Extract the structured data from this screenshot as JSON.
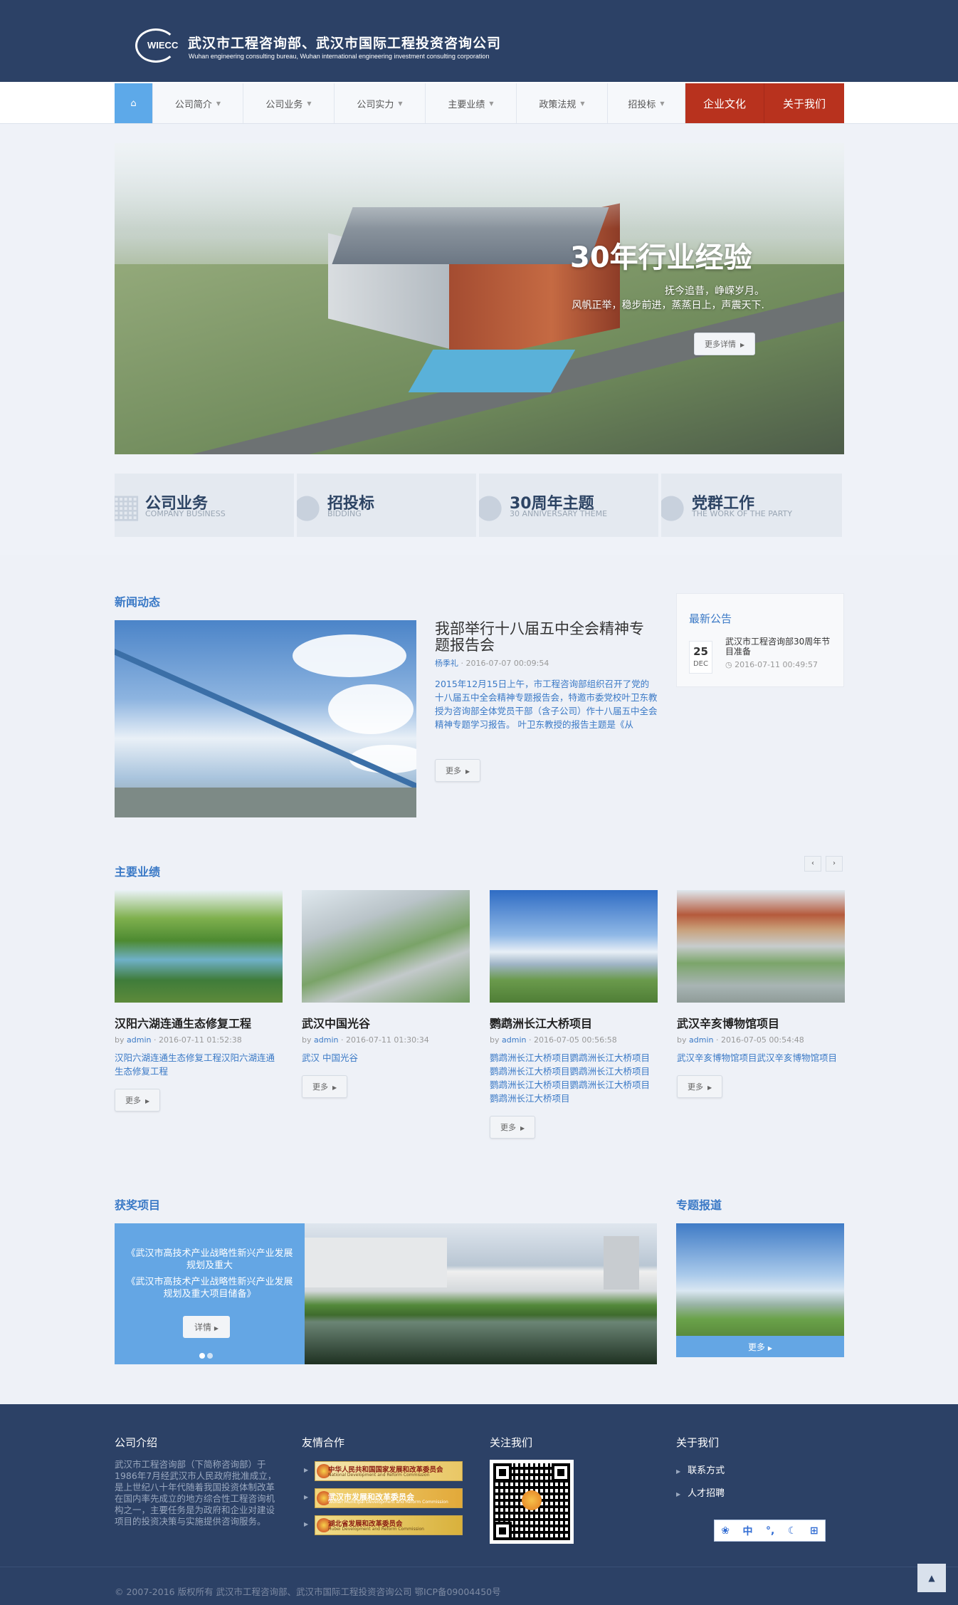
{
  "header": {
    "logo_abbr": "WIECC",
    "logo_cn": "武汉市工程咨询部、武汉市国际工程投资咨询公司",
    "logo_en": "Wuhan engineering consulting bureau, Wuhan international engineering investment consulting corporation"
  },
  "nav": {
    "home_icon": "home-icon",
    "items": [
      {
        "label": "公司简介"
      },
      {
        "label": "公司业务"
      },
      {
        "label": "公司实力"
      },
      {
        "label": "主要业绩"
      },
      {
        "label": "政策法规"
      },
      {
        "label": "招投标"
      }
    ],
    "culture": "企业文化",
    "about": "关于我们"
  },
  "banner": {
    "title": "30年行业经验",
    "line1": "抚今追昔，峥嵘岁月。",
    "line2": "风帆正举，稳步前进，蒸蒸日上，声震天下.",
    "button": "更多详情"
  },
  "features": [
    {
      "title": "公司业务",
      "sub": "COMPANY BUSINESS",
      "icon": "building-icon"
    },
    {
      "title": "招投标",
      "sub": "BIDDING",
      "icon": "hammer-icon"
    },
    {
      "title": "30周年主题",
      "sub": "30 ANNIVERSARY THEME",
      "icon": "user-icon"
    },
    {
      "title": "党群工作",
      "sub": "THE WORK OF THE PARTY",
      "icon": "users-icon"
    }
  ],
  "news": {
    "section": "新闻动态",
    "title": "我部举行十八届五中全会精神专题报告会",
    "author": "杨季礼",
    "date": "2016-07-07 00:09:54",
    "body": "2015年12月15日上午，市工程咨询部组织召开了党的十八届五中全会精神专题报告会，特邀市委党校叶卫东教授为咨询部全体党员干部（含子公司）作十八届五中全会精神专题学习报告。 叶卫东教授的报告主题是《从",
    "more": "更多"
  },
  "notice": {
    "title": "最新公告",
    "day": "25",
    "month": "DEC",
    "item": "武汉市工程咨询部30周年节目准备",
    "time": "2016-07-11 00:49:57"
  },
  "works": {
    "section": "主要业绩",
    "prev": "‹",
    "next": "›",
    "items": [
      {
        "title": "汉阳六湖连通生态修复工程",
        "author": "admin",
        "date": "2016-07-11 01:52:38",
        "desc": "汉阳六湖连通生态修复工程汉阳六湖连通生态修复工程",
        "more": "更多"
      },
      {
        "title": "武汉中国光谷",
        "author": "admin",
        "date": "2016-07-11 01:30:34",
        "desc": "武汉 中国光谷",
        "more": "更多"
      },
      {
        "title": "鹦鹉洲长江大桥项目",
        "author": "admin",
        "date": "2016-07-05 00:56:58",
        "desc": "鹦鹉洲长江大桥项目鹦鹉洲长江大桥项目鹦鹉洲长江大桥项目鹦鹉洲长江大桥项目鹦鹉洲长江大桥项目鹦鹉洲长江大桥项目鹦鹉洲长江大桥项目",
        "more": "更多"
      },
      {
        "title": "武汉辛亥博物馆项目",
        "author": "admin",
        "date": "2016-07-05 00:54:48",
        "desc": "武汉辛亥博物馆项目武汉辛亥博物馆项目",
        "more": "更多"
      }
    ]
  },
  "awards": {
    "section": "获奖项目",
    "quote1": "《武汉市高技术产业战略性新兴产业发展规划及重大",
    "quote2": "《武汉市高技术产业战略性新兴产业发展规划及重大项目储备》",
    "button": "详情"
  },
  "special": {
    "section": "专题报道",
    "more": "更多"
  },
  "footer": {
    "intro_title": "公司介绍",
    "intro_text": "武汉市工程咨询部（下简称咨询部）于1986年7月经武汉市人民政府批准成立，是上世纪八十年代随着我国投资体制改革在国内率先成立的地方综合性工程咨询机构之一，主要任务是为政府和企业对建设项目的投资决策与实施提供咨询服务。",
    "partners_title": "友情合作",
    "partners": [
      {
        "cn": "中华人民共和国国家发展和改革委员会",
        "en": "National Development and Reform Commission"
      },
      {
        "cn": "武汉市发展和改革委员会",
        "en": "Wuhan Municipal Development and Reform Commission"
      },
      {
        "cn": "湖北省发展和改革委员会",
        "en": "Hubei Development and Reform Commission"
      }
    ],
    "follow_title": "关注我们",
    "about_title": "关于我们",
    "about_items": [
      "联系方式",
      "人才招聘"
    ],
    "ime": [
      "中",
      "°,",
      "☾",
      "⊞"
    ],
    "copyright": "© 2007-2016 版权所有 武汉市工程咨询部、武汉市国际工程投资咨询公司 鄂ICP备09004450号"
  },
  "colors": {
    "header_bg": "#2c4166",
    "accent": "#3a79c6",
    "nav_red": "#b8321e",
    "light_blue": "#64a6e4"
  }
}
